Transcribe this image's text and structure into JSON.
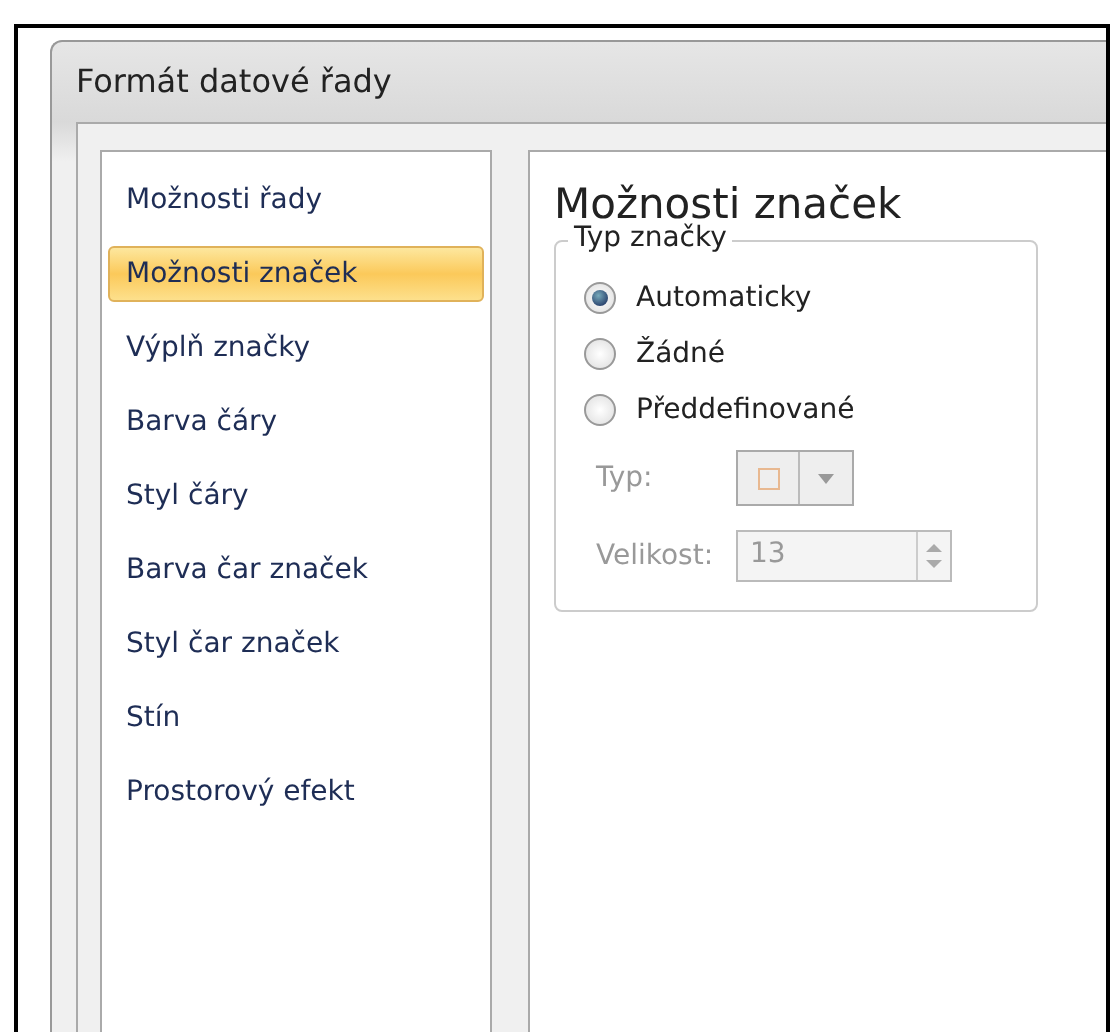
{
  "window": {
    "title": "Formát datové řady"
  },
  "sidebar": {
    "items": [
      {
        "label": "Možnosti řady",
        "selected": false
      },
      {
        "label": "Možnosti značek",
        "selected": true
      },
      {
        "label": "Výplň značky",
        "selected": false
      },
      {
        "label": "Barva čáry",
        "selected": false
      },
      {
        "label": "Styl čáry",
        "selected": false
      },
      {
        "label": "Barva čar značek",
        "selected": false
      },
      {
        "label": "Styl čar značek",
        "selected": false
      },
      {
        "label": "Stín",
        "selected": false
      },
      {
        "label": "Prostorový efekt",
        "selected": false
      }
    ]
  },
  "panel": {
    "title": "Možnosti značek",
    "group": {
      "legend": "Typ značky",
      "options": [
        {
          "label": "Automaticky",
          "selected": true
        },
        {
          "label": "Žádné",
          "selected": false
        },
        {
          "label": "Předdefinované",
          "selected": false
        }
      ],
      "type_field": {
        "label": "Typ:",
        "disabled": true
      },
      "size_field": {
        "label": "Velikost:",
        "value": "13",
        "disabled": true
      }
    }
  }
}
